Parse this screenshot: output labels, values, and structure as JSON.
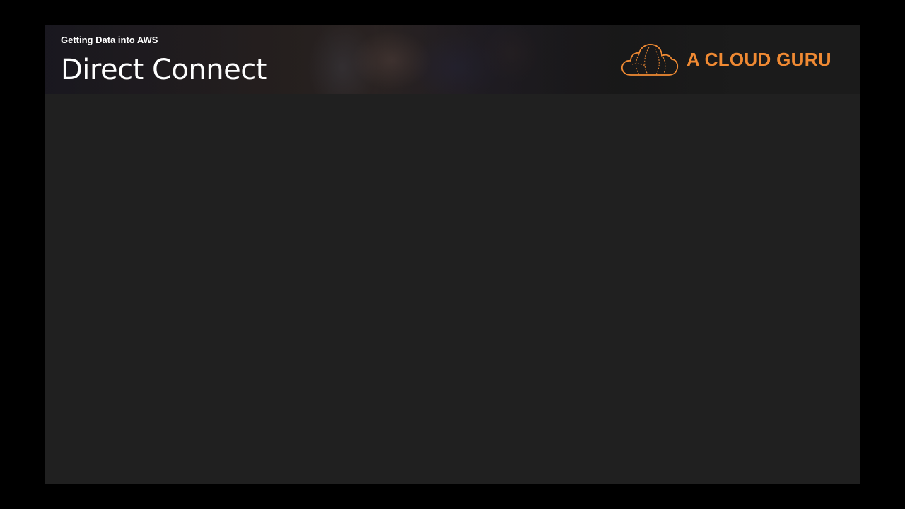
{
  "slide": {
    "subtitle": "Getting Data into AWS",
    "title": "Direct Connect"
  },
  "logo": {
    "text": "A CLOUD GURU",
    "icon": "cloud-icon",
    "color": "#f08a33"
  },
  "colors": {
    "background": "#000000",
    "slide": "#202020",
    "header": "#1b1b1b",
    "text": "#ffffff"
  }
}
